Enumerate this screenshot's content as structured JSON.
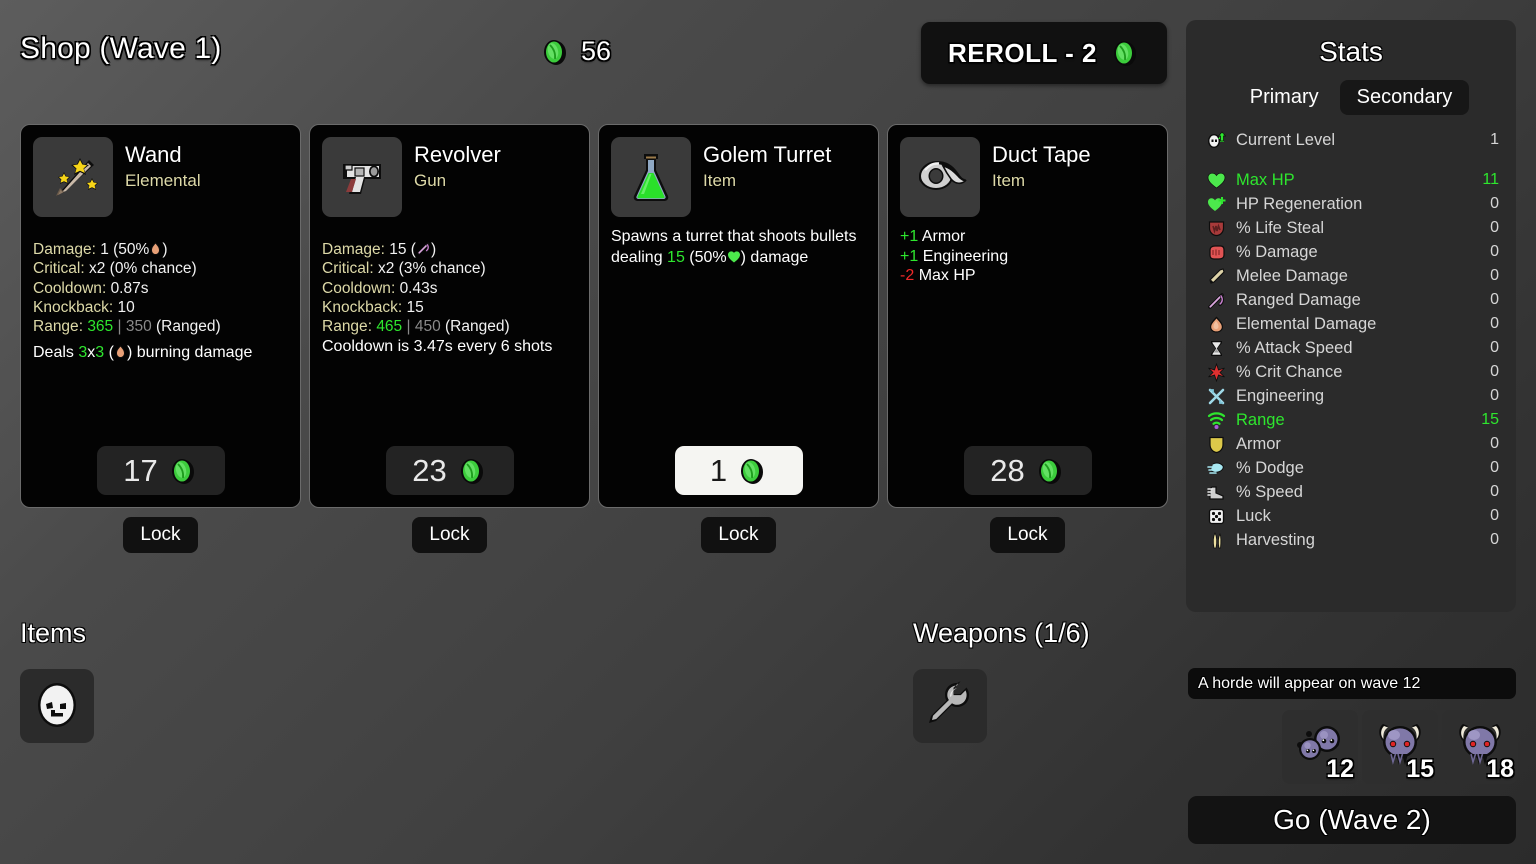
{
  "header": {
    "shop_title": "Shop (Wave 1)",
    "gold": "56",
    "gold_icon": "coin-icon",
    "reroll_label": "REROLL - 2"
  },
  "shop_cards": [
    {
      "name": "Wand",
      "type": "Elemental",
      "icon": "wand-icon",
      "stats": [
        {
          "key": "Damage",
          "value": "1 (50%",
          "suffix": ")",
          "icon": "flame-icon"
        },
        {
          "key": "Critical",
          "value": "x2 (0% chance)"
        },
        {
          "key": "Cooldown",
          "value": "0.87s"
        },
        {
          "key": "Knockback",
          "value": "10"
        },
        {
          "key": "Range",
          "value": "365",
          "value_alt": "350",
          "value_tail": "(Ranged)"
        }
      ],
      "effect": "Deals 3x3 ( ) burning damage",
      "effect_parts": [
        "Deals ",
        "3",
        "x",
        "3",
        " (",
        ") burning damage"
      ],
      "price": "17",
      "price_highlight": false,
      "lock_label": "Lock"
    },
    {
      "name": "Revolver",
      "type": "Gun",
      "icon": "revolver-icon",
      "stats": [
        {
          "key": "Damage",
          "value": "15 (",
          "suffix": ")",
          "icon": "bow-icon"
        },
        {
          "key": "Critical",
          "value": "x2 (3% chance)"
        },
        {
          "key": "Cooldown",
          "value": "0.43s"
        },
        {
          "key": "Knockback",
          "value": "15"
        },
        {
          "key": "Range",
          "value": "465",
          "value_alt": "450",
          "value_tail": "(Ranged)"
        }
      ],
      "effect": "Cooldown is 3.47s every 6 shots",
      "price": "23",
      "price_highlight": false,
      "lock_label": "Lock"
    },
    {
      "name": "Golem Turret",
      "type": "Item",
      "icon": "flask-icon",
      "description_parts": [
        "Spawns a turret that shoots bullets dealing ",
        "15",
        " (50%",
        ") damage"
      ],
      "price": "1",
      "price_highlight": true,
      "lock_label": "Lock"
    },
    {
      "name": "Duct Tape",
      "type": "Item",
      "icon": "tape-icon",
      "effects": [
        {
          "delta": "+1",
          "positive": true,
          "label": "Armor"
        },
        {
          "delta": "+1",
          "positive": true,
          "label": "Engineering"
        },
        {
          "delta": "-2",
          "positive": false,
          "label": "Max HP"
        }
      ],
      "price": "28",
      "price_highlight": false,
      "lock_label": "Lock"
    }
  ],
  "items_section": {
    "title": "Items",
    "slots": [
      {
        "icon": "potato-head-icon"
      }
    ]
  },
  "weapons_section": {
    "title": "Weapons (1/6)",
    "slots": [
      {
        "icon": "wrench-icon"
      }
    ]
  },
  "stats_panel": {
    "title": "Stats",
    "tabs": [
      {
        "label": "Primary",
        "active": false
      },
      {
        "label": "Secondary",
        "active": true
      }
    ],
    "level_row": {
      "icon": "level-up-icon",
      "label": "Current Level",
      "value": "1"
    },
    "rows": [
      {
        "icon": "heart-icon",
        "label": "Max HP",
        "value": "11",
        "highlight": true
      },
      {
        "icon": "heart-plus-icon",
        "label": "HP Regeneration",
        "value": "0",
        "highlight": false
      },
      {
        "icon": "lifesteal-icon",
        "label": "% Life Steal",
        "value": "0",
        "highlight": false
      },
      {
        "icon": "fist-icon",
        "label": "% Damage",
        "value": "0",
        "highlight": false
      },
      {
        "icon": "sword-icon",
        "label": "Melee Damage",
        "value": "0",
        "highlight": false
      },
      {
        "icon": "bow-icon",
        "label": "Ranged Damage",
        "value": "0",
        "highlight": false
      },
      {
        "icon": "flame-icon",
        "label": "Elemental Damage",
        "value": "0",
        "highlight": false
      },
      {
        "icon": "hourglass-icon",
        "label": "% Attack Speed",
        "value": "0",
        "highlight": false
      },
      {
        "icon": "crit-star-icon",
        "label": "% Crit Chance",
        "value": "0",
        "highlight": false
      },
      {
        "icon": "wrench-cross-icon",
        "label": "Engineering",
        "value": "0",
        "highlight": false
      },
      {
        "icon": "range-waves-icon",
        "label": "Range",
        "value": "15",
        "highlight": true
      },
      {
        "icon": "shield-icon",
        "label": "Armor",
        "value": "0",
        "highlight": false
      },
      {
        "icon": "dodge-icon",
        "label": "% Dodge",
        "value": "0",
        "highlight": false
      },
      {
        "icon": "boot-icon",
        "label": "% Speed",
        "value": "0",
        "highlight": false
      },
      {
        "icon": "dice-icon",
        "label": "Luck",
        "value": "0",
        "highlight": false
      },
      {
        "icon": "wheat-icon",
        "label": "Harvesting",
        "value": "0",
        "highlight": false
      }
    ]
  },
  "bottom_right": {
    "horde_message": "A horde will appear on wave 12",
    "enemies": [
      {
        "icon": "blob-pair-icon",
        "wave": "12"
      },
      {
        "icon": "horned-skull-icon",
        "wave": "15"
      },
      {
        "icon": "horned-skull-icon",
        "wave": "18"
      }
    ],
    "go_label": "Go (Wave 2)"
  },
  "colors": {
    "gold_green": "#2ee62e",
    "stat_key": "#ddd9a8",
    "negative_red": "#ef2a2a",
    "card_bg": "#030303",
    "panel_bg": "#2b2b2b"
  }
}
